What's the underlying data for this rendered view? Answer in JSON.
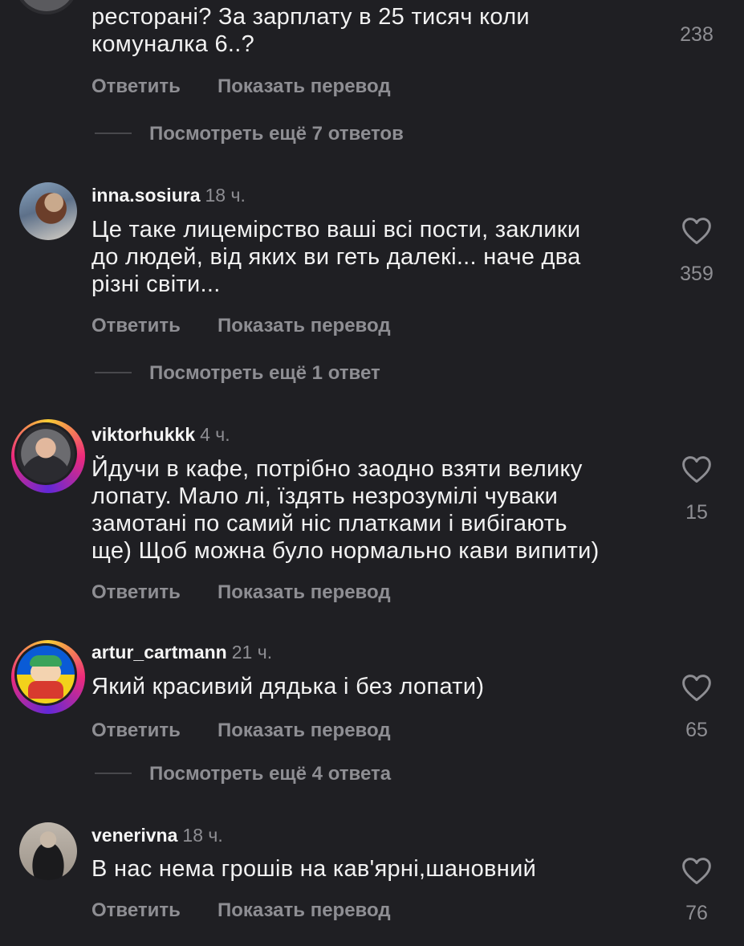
{
  "colors": {
    "background": "#1f1f23",
    "text": "#f2f2f2",
    "secondary": "#8e8e93"
  },
  "actions": {
    "reply": "Ответить",
    "translate": "Показать перевод"
  },
  "top_comment": {
    "lines": [
      "ресторані? За зарплату в 25 тисяч коли",
      "комуналка 6..?"
    ],
    "likes": "238",
    "more_replies": "Посмотреть ещё 7 ответов"
  },
  "comments": [
    {
      "username": "inna.sosiura",
      "time": "18 ч.",
      "lines": [
        "Це таке лицемірство ваші всі пости, заклики",
        "до людей, від яких ви геть далекі... наче два",
        "різні світи..."
      ],
      "likes": "359",
      "more_replies": "Посмотреть ещё 1 ответ"
    },
    {
      "username": "viktorhukkk",
      "time": "4 ч.",
      "lines": [
        "Йдучи в кафе, потрібно заодно взяти велику",
        "лопату. Мало лі, їздять незрозумілі чуваки",
        "замотані по самий ніс платками і вибігають",
        "ще) Щоб можна було нормально кави випити)"
      ],
      "likes": "15"
    },
    {
      "username": "artur_cartmann",
      "time": "21 ч.",
      "lines": [
        "Який красивий дядька і без лопати)"
      ],
      "likes": "65",
      "more_replies": "Посмотреть ещё 4 ответа"
    },
    {
      "username": "venerivna",
      "time": "18 ч.",
      "lines": [
        "В нас нема грошів на кав'ярні,шановний"
      ],
      "likes": "76"
    }
  ]
}
